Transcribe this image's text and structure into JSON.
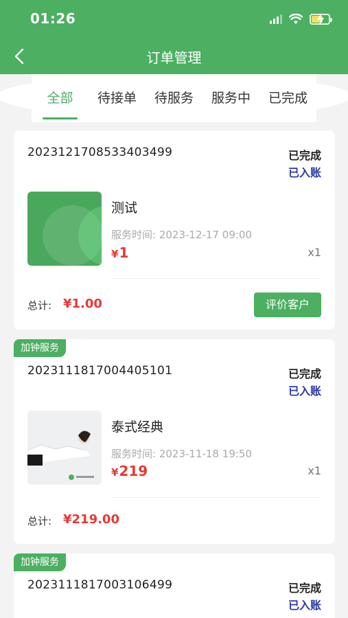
{
  "status_bar": {
    "time": "01:26"
  },
  "nav": {
    "title": "订单管理"
  },
  "tabs": [
    {
      "label": "全部",
      "active": true
    },
    {
      "label": "待接单",
      "active": false
    },
    {
      "label": "待服务",
      "active": false
    },
    {
      "label": "服务中",
      "active": false
    },
    {
      "label": "已完成",
      "active": false
    }
  ],
  "orders": [
    {
      "badge": "",
      "order_no": "2023121708533403499",
      "status": "已完成",
      "entry_status": "已入账",
      "product_name": "测试",
      "service_time_label": "服务时间:",
      "service_time": "2023-12-17 09:00",
      "currency": "¥",
      "price": "1",
      "qty": "x1",
      "total_label": "总计:",
      "total": "¥1.00",
      "action_label": "评价客户"
    },
    {
      "badge": "加钟服务",
      "order_no": "2023111817004405101",
      "status": "已完成",
      "entry_status": "已入账",
      "product_name": "泰式经典",
      "service_time_label": "服务时间:",
      "service_time": "2023-11-18 19:50",
      "currency": "¥",
      "price": "219",
      "qty": "x1",
      "total_label": "总计:",
      "total": "¥219.00"
    },
    {
      "badge": "加钟服务",
      "order_no": "2023111817003106499",
      "status": "已完成",
      "entry_status": "已入账"
    }
  ],
  "colors": {
    "primary": "#4caf62",
    "price": "#e53935",
    "entry": "#2b3aa8"
  }
}
